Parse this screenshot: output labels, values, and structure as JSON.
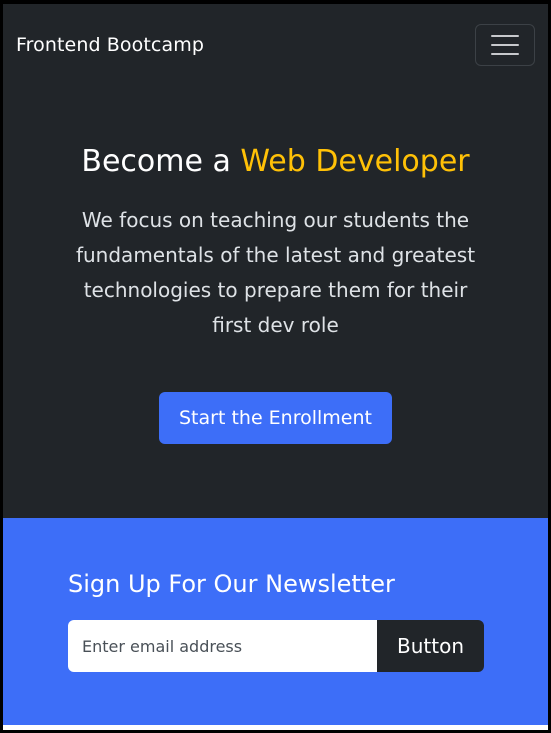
{
  "navbar": {
    "brand": "Frontend Bootcamp",
    "toggler_icon": "hamburger-menu-icon"
  },
  "hero": {
    "title_prefix": "Become a ",
    "title_accent": "Web Developer",
    "description": "We focus on teaching our students the fundamentals of the latest and greatest technologies to prepare them for their first dev role",
    "cta_label": "Start the Enrollment"
  },
  "newsletter": {
    "title": "Sign Up For Our Newsletter",
    "email_placeholder": "Enter email address",
    "email_value": "",
    "button_label": "Button"
  },
  "colors": {
    "dark": "#212529",
    "primary": "#3d6ef8",
    "accent": "#ffc107",
    "text_light": "#ffffff"
  }
}
